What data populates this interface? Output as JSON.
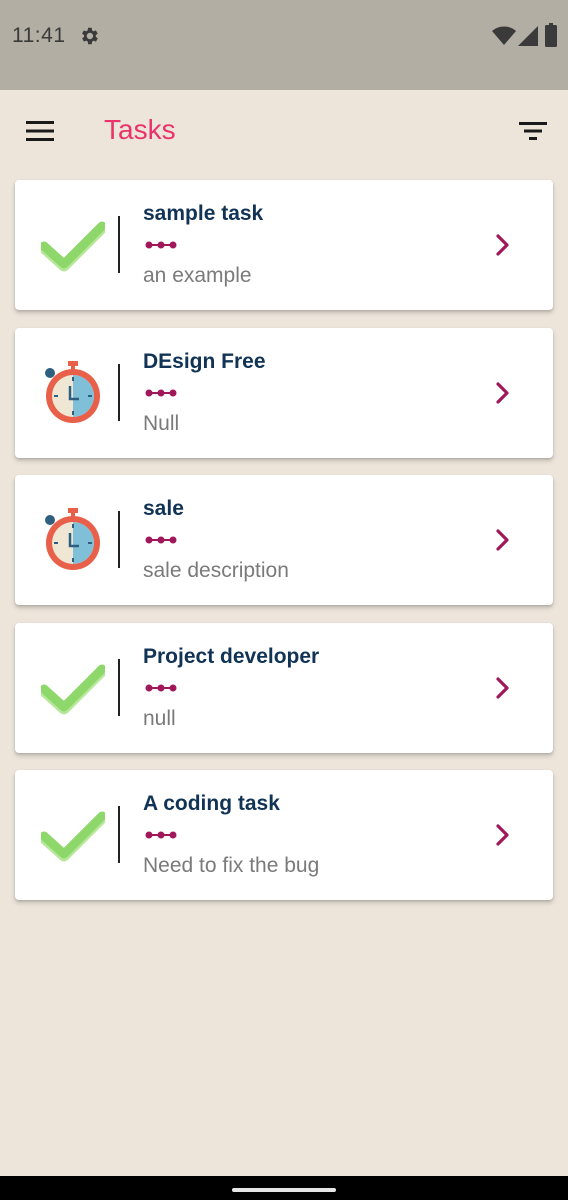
{
  "status_bar": {
    "time": "11:41"
  },
  "app_bar": {
    "title": "Tasks",
    "title_color": "#e8336b"
  },
  "tasks": [
    {
      "title": "sample task",
      "description": "an example",
      "status_icon": "check-icon"
    },
    {
      "title": "DEsign Free",
      "description": "Null",
      "status_icon": "stopwatch-icon"
    },
    {
      "title": "sale",
      "description": "sale description",
      "status_icon": "stopwatch-icon"
    },
    {
      "title": "Project developer",
      "description": "null",
      "status_icon": "check-icon"
    },
    {
      "title": "A coding task",
      "description": "Need to fix the bug",
      "status_icon": "check-icon"
    }
  ],
  "colors": {
    "background": "#ede5da",
    "status_bar": "#b2aea3",
    "accent": "#a0185a",
    "title_text": "#113355",
    "check_green": "#8ed86b",
    "stopwatch_red": "#e8604a"
  }
}
